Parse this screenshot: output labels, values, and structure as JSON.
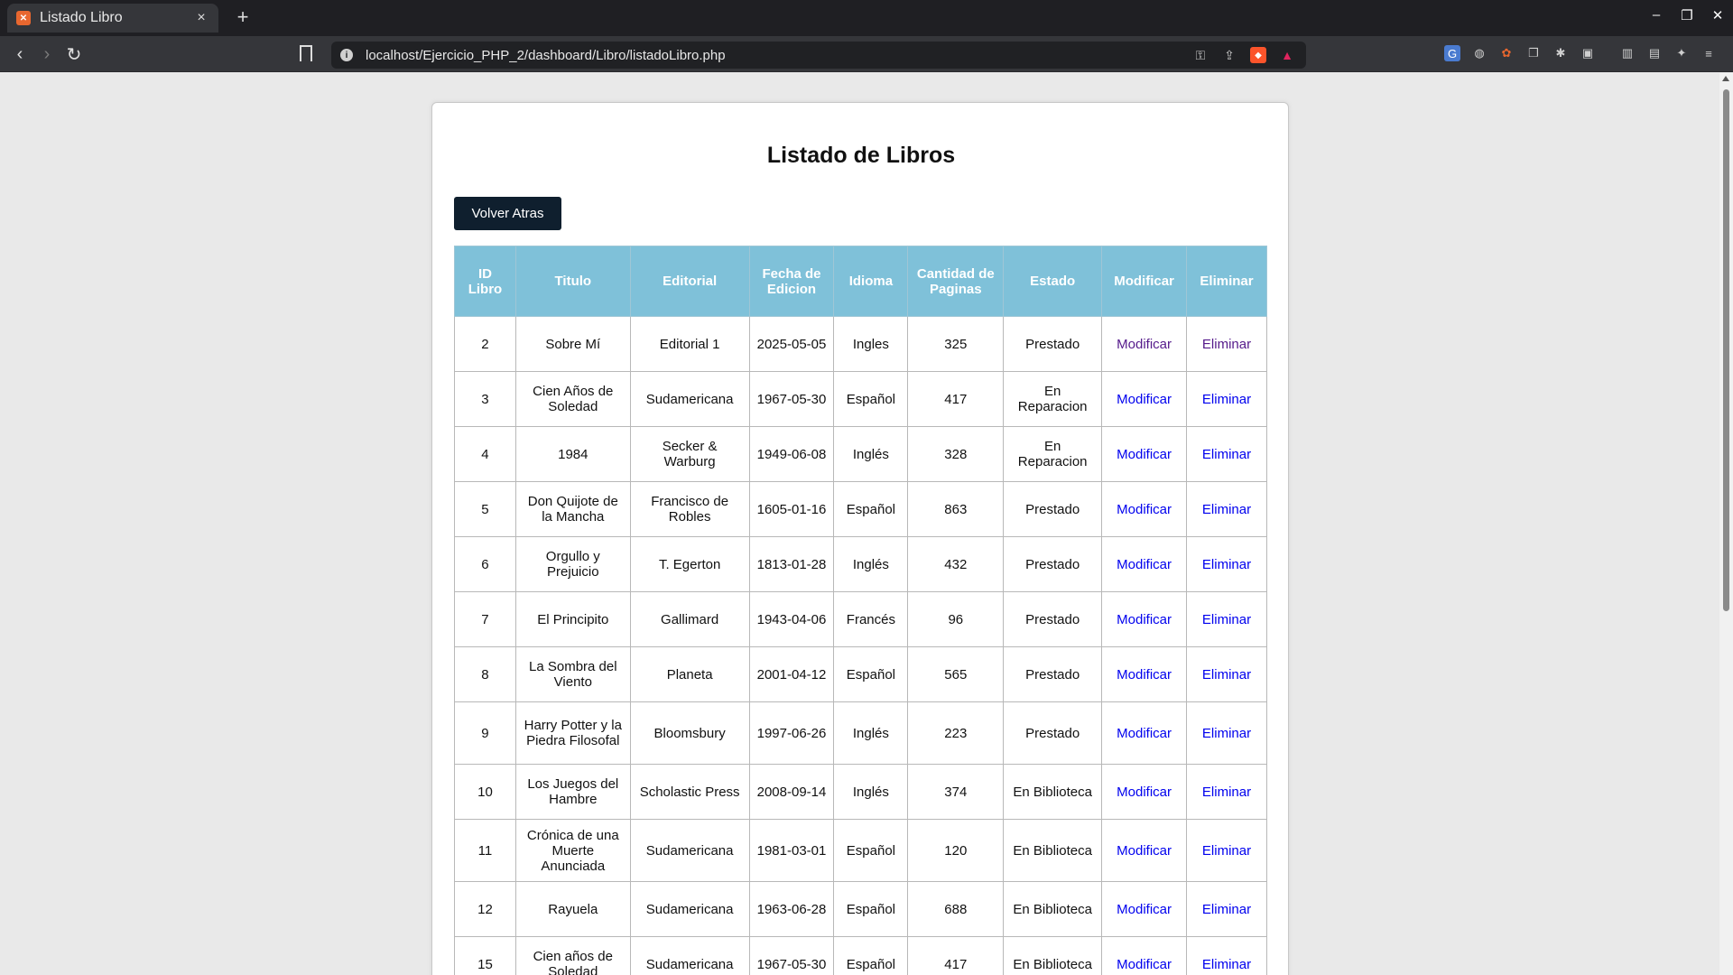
{
  "browser": {
    "tab_title": "Listado Libro",
    "tab_close": "×",
    "new_tab": "+",
    "url": "localhost/Ejercicio_PHP_2/dashboard/Libro/listadoLibro.php"
  },
  "page": {
    "title": "Listado de Libros",
    "back_button": "Volver Atras"
  },
  "table": {
    "headers": {
      "id": "ID Libro",
      "titulo": "Titulo",
      "editorial": "Editorial",
      "fecha": "Fecha de Edicion",
      "idioma": "Idioma",
      "paginas": "Cantidad de Paginas",
      "estado": "Estado",
      "modificar": "Modificar",
      "eliminar": "Eliminar"
    },
    "rows": [
      {
        "id": "2",
        "titulo": "Sobre Mí",
        "editorial": "Editorial 1",
        "fecha": "2025-05-05",
        "idioma": "Ingles",
        "paginas": "325",
        "estado": "Prestado",
        "modificar": "Modificar",
        "eliminar": "Eliminar"
      },
      {
        "id": "3",
        "titulo": "Cien Años de Soledad",
        "editorial": "Sudamericana",
        "fecha": "1967-05-30",
        "idioma": "Español",
        "paginas": "417",
        "estado": "En Reparacion",
        "modificar": "Modificar",
        "eliminar": "Eliminar"
      },
      {
        "id": "4",
        "titulo": "1984",
        "editorial": "Secker & Warburg",
        "fecha": "1949-06-08",
        "idioma": "Inglés",
        "paginas": "328",
        "estado": "En Reparacion",
        "modificar": "Modificar",
        "eliminar": "Eliminar"
      },
      {
        "id": "5",
        "titulo": "Don Quijote de la Mancha",
        "editorial": "Francisco de Robles",
        "fecha": "1605-01-16",
        "idioma": "Español",
        "paginas": "863",
        "estado": "Prestado",
        "modificar": "Modificar",
        "eliminar": "Eliminar"
      },
      {
        "id": "6",
        "titulo": "Orgullo y Prejuicio",
        "editorial": "T. Egerton",
        "fecha": "1813-01-28",
        "idioma": "Inglés",
        "paginas": "432",
        "estado": "Prestado",
        "modificar": "Modificar",
        "eliminar": "Eliminar"
      },
      {
        "id": "7",
        "titulo": "El Principito",
        "editorial": "Gallimard",
        "fecha": "1943-04-06",
        "idioma": "Francés",
        "paginas": "96",
        "estado": "Prestado",
        "modificar": "Modificar",
        "eliminar": "Eliminar"
      },
      {
        "id": "8",
        "titulo": "La Sombra del Viento",
        "editorial": "Planeta",
        "fecha": "2001-04-12",
        "idioma": "Español",
        "paginas": "565",
        "estado": "Prestado",
        "modificar": "Modificar",
        "eliminar": "Eliminar"
      },
      {
        "id": "9",
        "titulo": "Harry Potter y la Piedra Filosofal",
        "editorial": "Bloomsbury",
        "fecha": "1997-06-26",
        "idioma": "Inglés",
        "paginas": "223",
        "estado": "Prestado",
        "modificar": "Modificar",
        "eliminar": "Eliminar"
      },
      {
        "id": "10",
        "titulo": "Los Juegos del Hambre",
        "editorial": "Scholastic Press",
        "fecha": "2008-09-14",
        "idioma": "Inglés",
        "paginas": "374",
        "estado": "En Biblioteca",
        "modificar": "Modificar",
        "eliminar": "Eliminar"
      },
      {
        "id": "11",
        "titulo": "Crónica de una Muerte Anunciada",
        "editorial": "Sudamericana",
        "fecha": "1981-03-01",
        "idioma": "Español",
        "paginas": "120",
        "estado": "En Biblioteca",
        "modificar": "Modificar",
        "eliminar": "Eliminar"
      },
      {
        "id": "12",
        "titulo": "Rayuela",
        "editorial": "Sudamericana",
        "fecha": "1963-06-28",
        "idioma": "Español",
        "paginas": "688",
        "estado": "En Biblioteca",
        "modificar": "Modificar",
        "eliminar": "Eliminar"
      },
      {
        "id": "15",
        "titulo": "Cien años de Soledad",
        "editorial": "Sudamericana",
        "fecha": "1967-05-30",
        "idioma": "Español",
        "paginas": "417",
        "estado": "En Biblioteca",
        "modificar": "Modificar",
        "eliminar": "Eliminar"
      }
    ]
  }
}
